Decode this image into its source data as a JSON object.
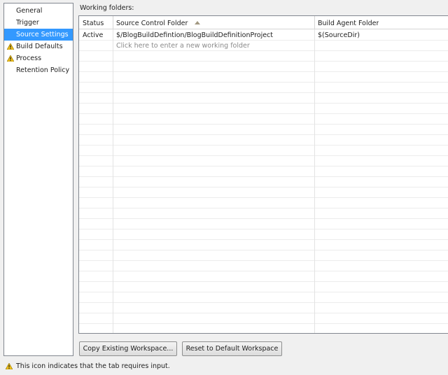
{
  "nav": {
    "items": [
      {
        "label": "General",
        "selected": false,
        "warning": false
      },
      {
        "label": "Trigger",
        "selected": false,
        "warning": false
      },
      {
        "label": "Source Settings",
        "selected": true,
        "warning": false
      },
      {
        "label": "Build Defaults",
        "selected": false,
        "warning": true
      },
      {
        "label": "Process",
        "selected": false,
        "warning": true
      },
      {
        "label": "Retention Policy",
        "selected": false,
        "warning": false
      }
    ]
  },
  "content": {
    "title": "Working folders:",
    "columns": [
      "Status",
      "Source Control Folder",
      "Build Agent Folder"
    ],
    "rows": [
      {
        "status": "Active",
        "source": "$/BlogBuildDefintion/BlogBuildDefinitionProject",
        "agent": "$(SourceDir)"
      }
    ],
    "new_row_placeholder": "Click here to enter a new working folder"
  },
  "buttons": {
    "copy_workspace": "Copy Existing Workspace...",
    "reset_workspace": "Reset to Default Workspace"
  },
  "footer": {
    "legend": "This icon indicates that the tab requires input."
  },
  "colors": {
    "selection": "#3399ff",
    "warning": "#f2c21a"
  }
}
